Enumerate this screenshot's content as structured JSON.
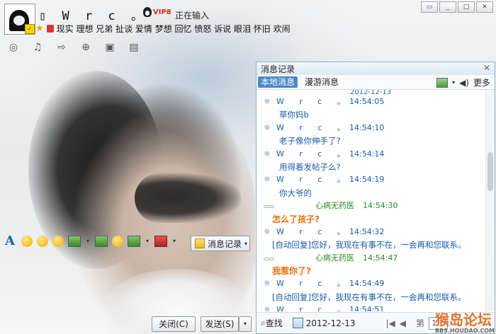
{
  "contact": {
    "name": "▯ W r c 。",
    "vip_badge": "VIP8",
    "status_text": "正在输入",
    "signature": "现实 理想 兄弟 扯谈 爱情 梦想 回忆 愤怒 诉说 眼泪 怀旧 欢闹"
  },
  "toolbar_icons": [
    "video-icon",
    "mic-icon",
    "file-transfer-icon",
    "invite-icon",
    "remote-desktop-icon",
    "app-icon"
  ],
  "format_icons": [
    "font-icon",
    "emoji-icon",
    "magic-emoji-icon",
    "shake-icon",
    "screenshot-icon",
    "image-icon",
    "music-icon",
    "more-icon",
    "toolbox-icon"
  ],
  "history_button": "消息记录",
  "footer": {
    "close_label": "关闭(C)",
    "send_label": "发送(S)"
  },
  "panel": {
    "title": "消息记录",
    "tabs": [
      "本地消息",
      "漫游消息"
    ],
    "more_label": "更多",
    "partial_top": "2012-12-13",
    "messages": [
      {
        "kind": "hdr",
        "sym": "☼",
        "name": "W r c 。",
        "time": "14:54:05"
      },
      {
        "kind": "body",
        "text": "草你妈b"
      },
      {
        "kind": "hdr",
        "sym": "☼",
        "name": "W r c 。",
        "time": "14:54:10"
      },
      {
        "kind": "body",
        "text": "老子像你伸手了?"
      },
      {
        "kind": "hdr",
        "sym": "☼",
        "name": "W r c 。",
        "time": "14:54:14"
      },
      {
        "kind": "body",
        "text": "用得着发帖子么?"
      },
      {
        "kind": "hdr",
        "sym": "☼",
        "name": "W r c 。",
        "time": "14:54:19"
      },
      {
        "kind": "body",
        "text": "你大爷的"
      },
      {
        "kind": "hdr-other",
        "sym": "▭▭",
        "name": "心病无药医",
        "time": "14:54:30"
      },
      {
        "kind": "orange",
        "text": "怎么了孩子?"
      },
      {
        "kind": "hdr",
        "sym": "☼",
        "name": "W r c 。",
        "time": "14:54:32"
      },
      {
        "kind": "auto",
        "text": "[自动回复]您好，我现在有事不在，一会再和您联系。"
      },
      {
        "kind": "hdr-other",
        "sym": "▭▭",
        "name": "心病无药医",
        "time": "14:54:47"
      },
      {
        "kind": "orange",
        "text": "我惹你了?"
      },
      {
        "kind": "hdr",
        "sym": "☼",
        "name": "W r c 。",
        "time": "14:54:49"
      },
      {
        "kind": "auto",
        "text": "[自动回复]您好，我现在有事不在，一会再和您联系。"
      },
      {
        "kind": "hdr",
        "sym": "☼",
        "name": "W r c 。",
        "time": "14:54:51"
      }
    ],
    "search_label": "查找",
    "date": "2012-12-13",
    "page_label": "第",
    "page_value": "1"
  },
  "watermark": {
    "main": "猴岛论坛",
    "sub": "BBS.HOUDAO.COM"
  }
}
